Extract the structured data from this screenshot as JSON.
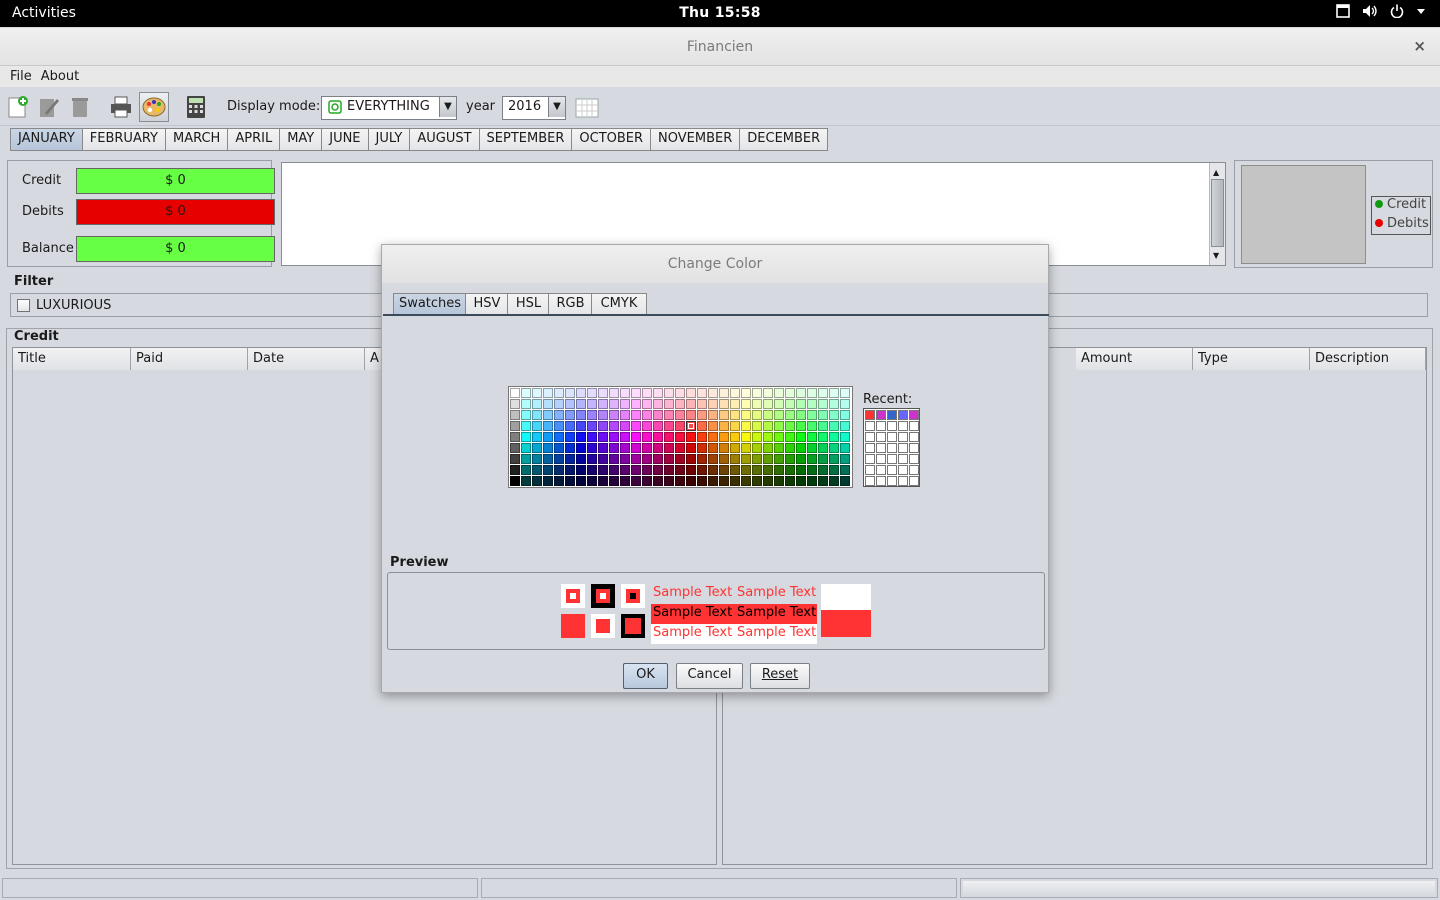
{
  "desktop": {
    "activities": "Activities",
    "clock": "Thu 15:58"
  },
  "window": {
    "title": "Financien",
    "close_label": "×"
  },
  "menu": {
    "file": "File",
    "about": "About"
  },
  "toolbar": {
    "display_mode_label": "Display mode:",
    "display_mode_value": "EVERYTHING",
    "year_label": "year",
    "year_value": "2016",
    "combo_arrow": "▼"
  },
  "months": [
    "JANUARY",
    "FEBRUARY",
    "MARCH",
    "APRIL",
    "MAY",
    "JUNE",
    "JULY",
    "AUGUST",
    "SEPTEMBER",
    "OCTOBER",
    "NOVEMBER",
    "DECEMBER"
  ],
  "summary": {
    "credit_label": "Credit",
    "credit_value": "$ 0",
    "debits_label": "Debits",
    "debits_value": "$ 0",
    "balance_label": "Balance",
    "balance_value": "$ 0"
  },
  "chart_legend": {
    "credit": "Credit",
    "debits": "Debits"
  },
  "filter": {
    "title": "Filter",
    "checkbox_label": "LUXURIOUS"
  },
  "credit_table": {
    "title": "Credit",
    "columns": [
      "Title",
      "Paid",
      "Date",
      "A"
    ]
  },
  "debit_table": {
    "columns": [
      "Amount",
      "Type",
      "Description"
    ]
  },
  "dialog": {
    "title": "Change Color",
    "tabs": [
      "Swatches",
      "HSV",
      "HSL",
      "RGB",
      "CMYK"
    ],
    "recent_label": "Recent:",
    "preview_label": "Preview",
    "sample_text": "Sample Text",
    "ok": "OK",
    "cancel": "Cancel",
    "reset": "Reset"
  },
  "colors": {
    "credit_green": "#66ff44",
    "debit_red": "#e60000",
    "selected_color": "#ff3333",
    "tab_selected": "#c1cee0"
  }
}
